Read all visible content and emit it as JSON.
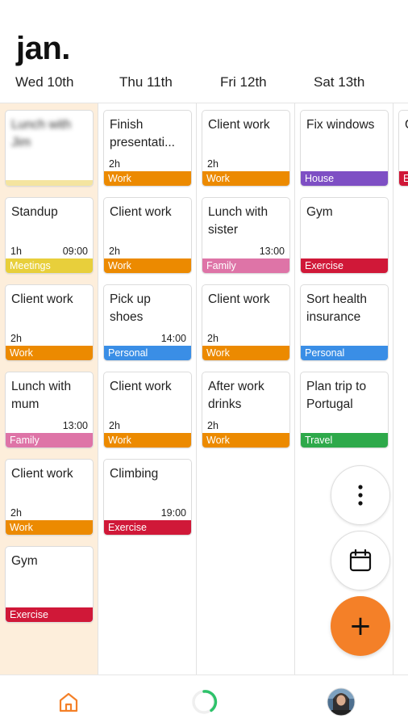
{
  "header": {
    "month": "jan.",
    "days": [
      {
        "label": "Wed 10th",
        "today": true
      },
      {
        "label": "Thu 11th",
        "today": false
      },
      {
        "label": "Fri 12th",
        "today": false
      },
      {
        "label": "Sat 13th",
        "today": false
      }
    ]
  },
  "colors": {
    "Work": "#ec8a00",
    "Meetings": "#e8cf3b",
    "Family": "#de74a7",
    "Exercise": "#d01838",
    "Personal": "#3a8ee6",
    "House": "#7e4fc4",
    "Travel": "#2ea94a",
    "Blurred": "#f4e4a0",
    "accent": "#f48028",
    "today_bg": "#fdeedb"
  },
  "columns": [
    {
      "day": "Wed 10th",
      "events": [
        {
          "title": "Lunch with Jim",
          "duration": "",
          "time": "",
          "tag": "",
          "blurred": true
        },
        {
          "title": "Standup",
          "duration": "1h",
          "time": "09:00",
          "tag": "Meetings"
        },
        {
          "title": "Client work",
          "duration": "2h",
          "time": "",
          "tag": "Work"
        },
        {
          "title": "Lunch with mum",
          "duration": "",
          "time": "13:00",
          "tag": "Family"
        },
        {
          "title": "Client work",
          "duration": "2h",
          "time": "",
          "tag": "Work"
        },
        {
          "title": "Gym",
          "duration": "",
          "time": "",
          "tag": "Exercise"
        }
      ]
    },
    {
      "day": "Thu 11th",
      "events": [
        {
          "title": "Finish presentati...",
          "duration": "2h",
          "time": "",
          "tag": "Work"
        },
        {
          "title": "Client work",
          "duration": "2h",
          "time": "",
          "tag": "Work"
        },
        {
          "title": "Pick up shoes",
          "duration": "",
          "time": "14:00",
          "tag": "Personal"
        },
        {
          "title": "Client work",
          "duration": "2h",
          "time": "",
          "tag": "Work"
        },
        {
          "title": "Climbing",
          "duration": "",
          "time": "19:00",
          "tag": "Exercise"
        }
      ]
    },
    {
      "day": "Fri 12th",
      "events": [
        {
          "title": "Client work",
          "duration": "2h",
          "time": "",
          "tag": "Work"
        },
        {
          "title": "Lunch with sister",
          "duration": "",
          "time": "13:00",
          "tag": "Family"
        },
        {
          "title": "Client work",
          "duration": "2h",
          "time": "",
          "tag": "Work"
        },
        {
          "title": "After work drinks",
          "duration": "2h",
          "time": "",
          "tag": "Work"
        }
      ]
    },
    {
      "day": "Sat 13th",
      "events": [
        {
          "title": "Fix windows",
          "duration": "",
          "time": "",
          "tag": "House"
        },
        {
          "title": "Gym",
          "duration": "",
          "time": "",
          "tag": "Exercise"
        },
        {
          "title": "Sort health insurance",
          "duration": "",
          "time": "",
          "tag": "Personal"
        },
        {
          "title": "Plan trip to Portugal",
          "duration": "",
          "time": "",
          "tag": "Travel"
        }
      ]
    },
    {
      "day": "",
      "events": [
        {
          "title": "G",
          "duration": "",
          "time": "",
          "tag": "E"
        }
      ]
    }
  ],
  "actions": {
    "more_icon": "more-vertical-icon",
    "calendar_icon": "calendar-icon",
    "add_label": "+"
  },
  "nav": {
    "home_icon": "home-icon",
    "progress_icon": "progress-ring-icon",
    "avatar_icon": "avatar"
  }
}
